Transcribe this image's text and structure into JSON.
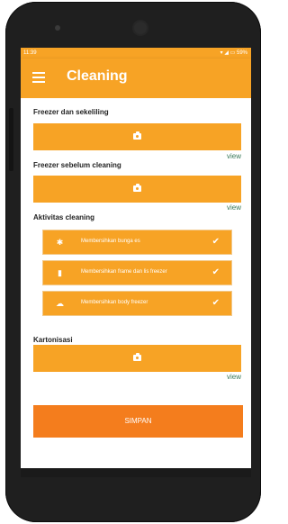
{
  "status_bar": {
    "time": "11:39",
    "battery": "59%"
  },
  "app_bar": {
    "title": "Cleaning"
  },
  "sections": {
    "freezer_surroundings": {
      "title": "Freezer dan sekeliling",
      "view_label": "view"
    },
    "freezer_before": {
      "title": "Freezer sebelum cleaning",
      "view_label": "view"
    },
    "activities": {
      "title": "Aktivitas cleaning",
      "items": [
        {
          "label": "Membersihkan bunga es",
          "icon": "snowflake-icon",
          "checked": true
        },
        {
          "label": "Membersihkan frame dan lis freezer",
          "icon": "spray-icon",
          "checked": true
        },
        {
          "label": "Membersihkan body freezer",
          "icon": "cloud-icon",
          "checked": true
        }
      ]
    },
    "cartonization": {
      "title": "Kartonisasi",
      "view_label": "view"
    }
  },
  "save_button": {
    "label": "SIMPAN"
  },
  "colors": {
    "accent": "#f7a325",
    "save": "#f47d1d",
    "link": "#3a7a5a"
  }
}
